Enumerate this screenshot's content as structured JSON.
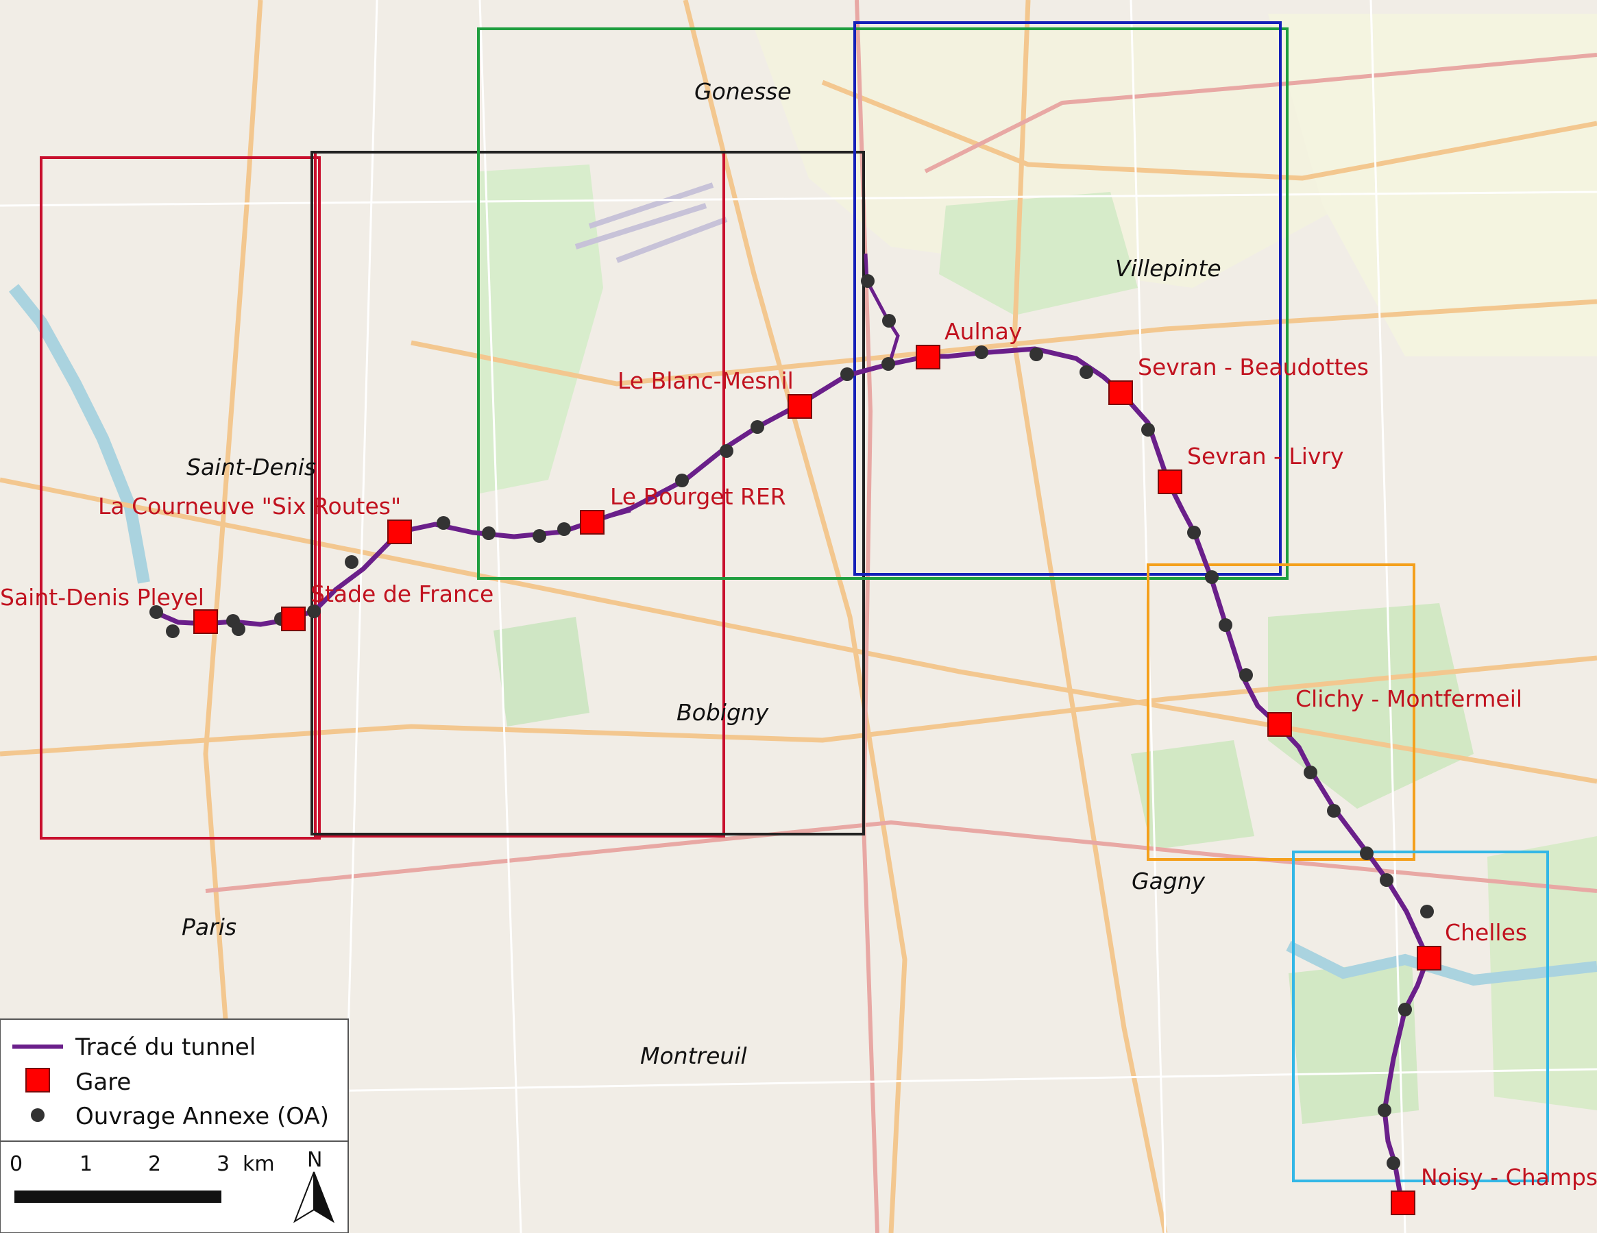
{
  "colors": {
    "tunnel": "#6a1f8a",
    "station": "#ff0000",
    "station_stroke": "#7a0a0a",
    "shaft": "#333333",
    "label": "#c1121f",
    "box_red": "#c8102e",
    "box_black": "#222222",
    "box_green": "#1f9e3f",
    "box_blue": "#1420b8",
    "box_orange": "#f4a01c",
    "box_cyan": "#33b7e6"
  },
  "stations": [
    {
      "id": "saint-denis-pleyel",
      "label": "Saint-Denis Pleyel"
    },
    {
      "id": "stade-de-france",
      "label": "Stade de France"
    },
    {
      "id": "la-courneuve",
      "label": "La Courneuve \"Six Routes\""
    },
    {
      "id": "le-bourget",
      "label": "Le Bourget RER"
    },
    {
      "id": "le-blanc-mesnil",
      "label": "Le Blanc-Mesnil"
    },
    {
      "id": "aulnay",
      "label": "Aulnay"
    },
    {
      "id": "sevran-beaudottes",
      "label": "Sevran - Beaudottes"
    },
    {
      "id": "sevran-livry",
      "label": "Sevran - Livry"
    },
    {
      "id": "clichy-montfermeil",
      "label": "Clichy - Montfermeil"
    },
    {
      "id": "chelles",
      "label": "Chelles"
    },
    {
      "id": "noisy-champs",
      "label": "Noisy - Champs"
    }
  ],
  "cities": {
    "gonesse": "Gonesse",
    "villepinte": "Villepinte",
    "saint_denis": "Saint-Denis",
    "bobigny": "Bobigny",
    "gagny": "Gagny",
    "paris": "Paris",
    "montreuil": "Montreuil"
  },
  "legend": {
    "tunnel": "Tracé du tunnel",
    "station": "Gare",
    "shaft": "Ouvrage Annexe (OA)"
  },
  "scale": {
    "ticks": [
      "0",
      "1",
      "2",
      "3"
    ],
    "unit": "km",
    "north": "N"
  }
}
